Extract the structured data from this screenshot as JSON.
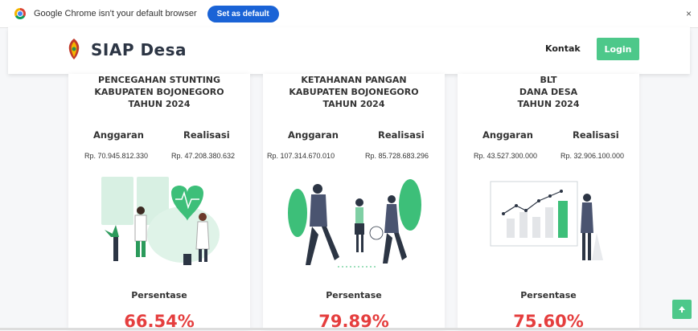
{
  "infobar": {
    "message": "Google Chrome isn't your default browser",
    "button": "Set as default",
    "close": "×"
  },
  "navbar": {
    "brand": "SIAP Desa",
    "links": {
      "kontak": "Kontak",
      "login": "Login"
    }
  },
  "cards": [
    {
      "title_lines": [
        "PENCEGAHAN STUNTING",
        "KABUPATEN BOJONEGORO",
        "TAHUN 2024"
      ],
      "anggaran_label": "Anggaran",
      "realisasi_label": "Realisasi",
      "anggaran_value": "Rp. 70.945.812.330",
      "realisasi_value": "Rp. 47.208.380.632",
      "persentase_label": "Persentase",
      "persentase_value": "66.54%"
    },
    {
      "title_lines": [
        "KETAHANAN PANGAN",
        "KABUPATEN BOJONEGORO",
        "TAHUN 2024"
      ],
      "anggaran_label": "Anggaran",
      "realisasi_label": "Realisasi",
      "anggaran_value": "Rp. 107.314.670.010",
      "realisasi_value": "Rp. 85.728.683.296",
      "persentase_label": "Persentase",
      "persentase_value": "79.89%"
    },
    {
      "title_lines": [
        "BLT",
        "DANA DESA",
        "TAHUN 2024"
      ],
      "anggaran_label": "Anggaran",
      "realisasi_label": "Realisasi",
      "anggaran_value": "Rp. 43.527.300.000",
      "realisasi_value": "Rp. 32.906.100.000",
      "persentase_label": "Persentase",
      "persentase_value": "75.60%"
    }
  ],
  "scroll_top_icon": "arrow-up-icon",
  "colors": {
    "accent": "#4dc88a",
    "percentage": "#e53e3e",
    "chrome_button": "#1a63d6"
  }
}
